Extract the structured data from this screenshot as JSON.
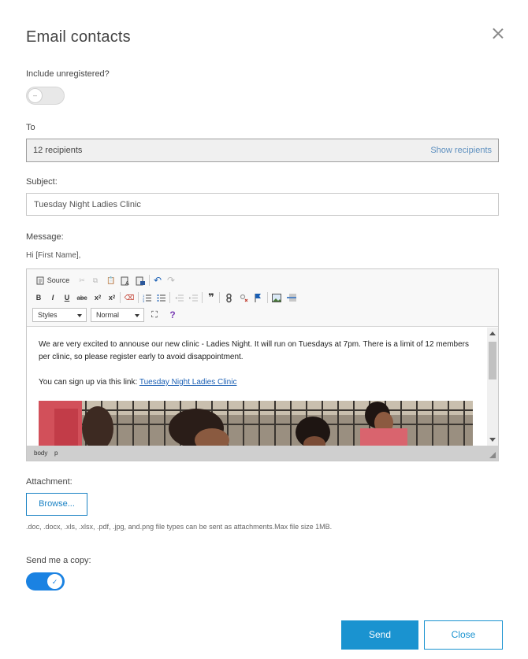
{
  "dialog": {
    "title": "Email contacts",
    "close_icon": "close-icon"
  },
  "include_unregistered": {
    "label": "Include unregistered?",
    "enabled": false,
    "knob_glyph": "–"
  },
  "to": {
    "label": "To",
    "recipients": "12 recipients",
    "show_recipients": "Show recipients"
  },
  "subject": {
    "label": "Subject:",
    "value": "Tuesday Night Ladies Clinic"
  },
  "message": {
    "label": "Message:",
    "greeting": "Hi [First Name],",
    "toolbar": {
      "source": "Source",
      "bold": "B",
      "italic": "I",
      "underline": "U",
      "strike": "abc",
      "subscript": "x",
      "superscript": "x",
      "styles_select": "Styles",
      "format_select": "Normal",
      "quote": "❞",
      "help": "?"
    },
    "body": {
      "paragraph1": "We are very excited to annouse our new clinic - Ladies Night. It will run on Tuesdays at 7pm. There is a limit of 12 members per clinic, so please register early to avoid disappointment.",
      "paragraph2_prefix": "You can sign up via this link: ",
      "link_text": "Tuesday Night Ladies Clinic"
    },
    "statusbar": {
      "tag1": "body",
      "tag2": "p"
    }
  },
  "attachment": {
    "label": "Attachment:",
    "browse": "Browse...",
    "hint": ".doc, .docx, .xls, .xlsx, .pdf, .jpg, and.png file types can be sent as attachments.Max file size 1MB."
  },
  "send_copy": {
    "label": "Send me a copy:",
    "enabled": true,
    "knob_glyph": "✓"
  },
  "footer": {
    "send": "Send",
    "close": "Close"
  },
  "colors": {
    "primary": "#1a93d0",
    "toggle_on": "#1a82e2",
    "link": "#5d8fbf"
  }
}
